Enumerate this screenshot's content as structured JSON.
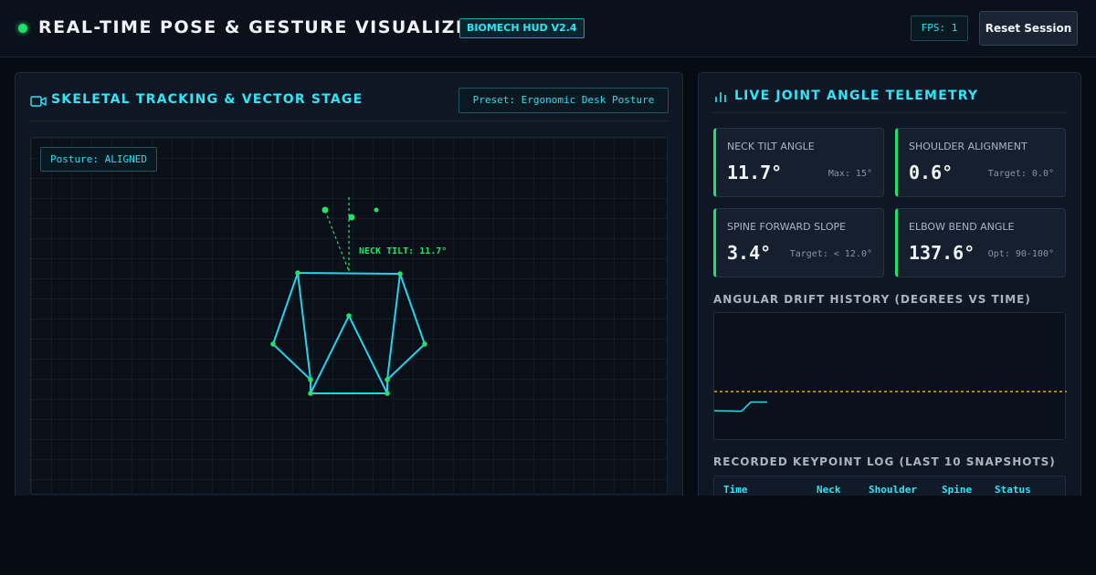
{
  "header": {
    "title": "REAL-TIME POSE & GESTURE VISUALIZER",
    "version_badge": "BIOMECH HUD V2.4",
    "fps": "FPS: 1",
    "reset_label": "Reset Session"
  },
  "stage_panel": {
    "title": "SKELETAL TRACKING & VECTOR STAGE",
    "preset": "Preset: Ergonomic Desk Posture",
    "posture": "Posture: ALIGNED",
    "neck_tilt_label": "NECK TILT: 11.7°"
  },
  "telemetry": {
    "title": "LIVE JOINT ANGLE TELEMETRY",
    "metrics": [
      {
        "label": "NECK TILT ANGLE",
        "value": "11.7°",
        "sub": "Max: 15°"
      },
      {
        "label": "SHOULDER ALIGNMENT",
        "value": "0.6°",
        "sub": "Target: 0.0°"
      },
      {
        "label": "SPINE FORWARD SLOPE",
        "value": "3.4°",
        "sub": "Target: < 12.0°"
      },
      {
        "label": "ELBOW BEND ANGLE",
        "value": "137.6°",
        "sub": "Opt: 90-100°"
      }
    ],
    "drift_title": "ANGULAR DRIFT HISTORY (DEGREES VS TIME)",
    "log_title": "RECORDED KEYPOINT LOG (LAST 10 SNAPSHOTS)",
    "log_columns": [
      "Time",
      "Neck",
      "Shoulder",
      "Spine",
      "Status"
    ]
  },
  "colors": {
    "accent_cyan": "#2ee6f5",
    "accent_green": "#22e06b",
    "threshold_amber": "#a7861f"
  }
}
